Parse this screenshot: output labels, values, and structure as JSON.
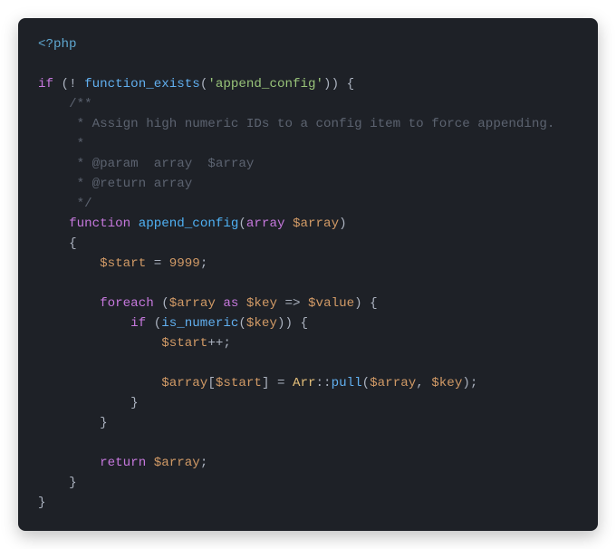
{
  "code": {
    "open_tag": "<?php",
    "kw_if": "if",
    "not": "!",
    "fn_function_exists": "function_exists",
    "str_append_config": "'append_config'",
    "brace_open": "{",
    "brace_close": "}",
    "paren_open": "(",
    "paren_close": ")",
    "doc1": "/**",
    "doc2": " * Assign high numeric IDs to a config item to force appending.",
    "doc3": " *",
    "doc4": " * @param  array  $array",
    "doc5": " * @return array",
    "doc6": " */",
    "kw_function": "function",
    "fn_def": "append_config",
    "type_array": "array",
    "var_array": "$array",
    "var_start": "$start",
    "eq": "=",
    "num_9999": "9999",
    "semi": ";",
    "kw_foreach": "foreach",
    "kw_as": "as",
    "var_key": "$key",
    "arrow": "=>",
    "var_value": "$value",
    "kw_if2": "if",
    "fn_is_numeric": "is_numeric",
    "pp": "++",
    "lbrack": "[",
    "rbrack": "]",
    "cls_Arr": "Arr",
    "dblcolon": "::",
    "fn_pull": "pull",
    "comma": ",",
    "kw_return": "return"
  }
}
